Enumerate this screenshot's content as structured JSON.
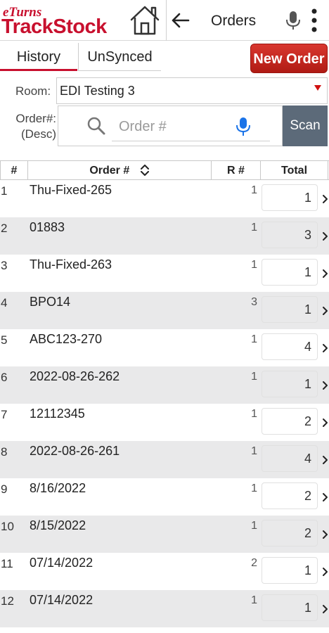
{
  "header": {
    "logo_small": "eTurns",
    "logo_big": "TrackStock",
    "title": "Orders"
  },
  "tabs": [
    {
      "label": "History",
      "active": true
    },
    {
      "label": "UnSynced",
      "active": false
    }
  ],
  "new_order_label": "New Order",
  "room": {
    "label": "Room:",
    "value": "EDI Testing 3"
  },
  "order_search": {
    "label_line1": "Order#:",
    "label_line2": "(Desc)",
    "placeholder": "Order #",
    "value": "",
    "scan_label": "Scan"
  },
  "table": {
    "headers": {
      "num": "#",
      "order": "Order #",
      "r": "R #",
      "total": "Total"
    },
    "rows": [
      {
        "num": "1",
        "order": "Thu-Fixed-265",
        "r": "1",
        "total": "1"
      },
      {
        "num": "2",
        "order": "01883",
        "r": "1",
        "total": "3"
      },
      {
        "num": "3",
        "order": "Thu-Fixed-263",
        "r": "1",
        "total": "1"
      },
      {
        "num": "4",
        "order": "BPO14",
        "r": "3",
        "total": "1"
      },
      {
        "num": "5",
        "order": "ABC123-270",
        "r": "1",
        "total": "4"
      },
      {
        "num": "6",
        "order": "2022-08-26-262",
        "r": "1",
        "total": "1"
      },
      {
        "num": "7",
        "order": "12112345",
        "r": "1",
        "total": "2"
      },
      {
        "num": "8",
        "order": "2022-08-26-261",
        "r": "1",
        "total": "4"
      },
      {
        "num": "9",
        "order": "8/16/2022",
        "r": "1",
        "total": "2"
      },
      {
        "num": "10",
        "order": "8/15/2022",
        "r": "1",
        "total": "2"
      },
      {
        "num": "11",
        "order": "07/14/2022",
        "r": "2",
        "total": "1"
      },
      {
        "num": "12",
        "order": "07/14/2022",
        "r": "1",
        "total": "1"
      }
    ]
  },
  "colors": {
    "brand_red": "#c8102e",
    "scan_button": "#5c6a79",
    "row_alt": "#e9e9ea",
    "mic_blue": "#1a73e8"
  }
}
